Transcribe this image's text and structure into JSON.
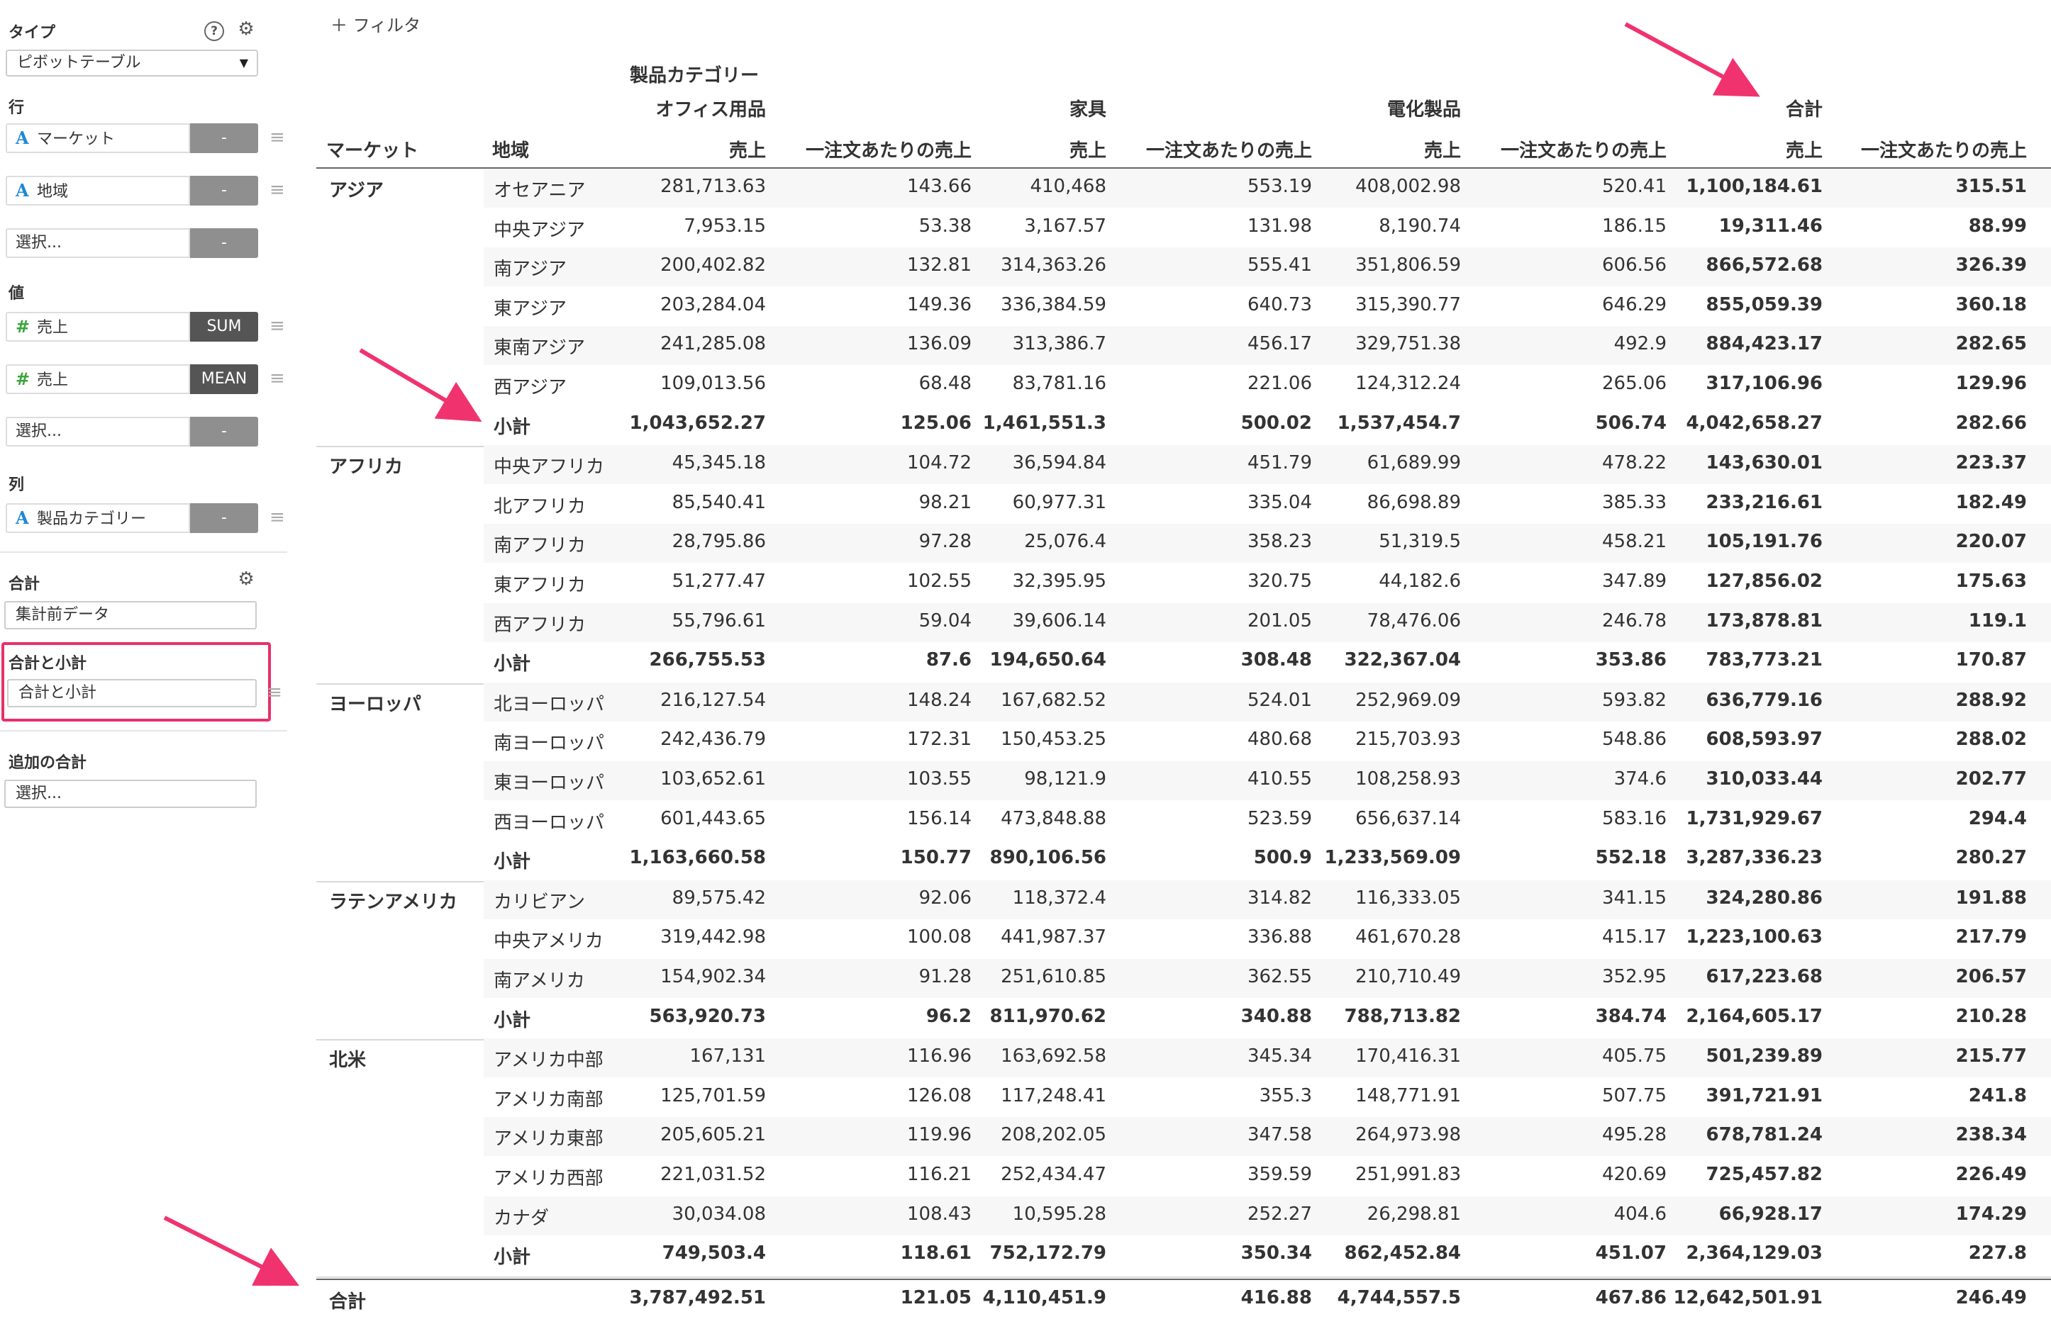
{
  "panel": {
    "type_label": "タイプ",
    "type_value": "ピボットテーブル",
    "rows_label": "行",
    "rows": [
      {
        "icon": "text-type-icon",
        "glyph": "A",
        "name": "マーケット",
        "agg": "-"
      },
      {
        "icon": "text-type-icon",
        "glyph": "A",
        "name": "地域",
        "agg": "-"
      },
      {
        "icon": "",
        "glyph": "",
        "name": "選択...",
        "agg": "-"
      }
    ],
    "values_label": "値",
    "values": [
      {
        "icon": "number-type-icon",
        "glyph": "#",
        "name": "売上",
        "agg": "SUM"
      },
      {
        "icon": "number-type-icon",
        "glyph": "#",
        "name": "売上",
        "agg": "MEAN"
      },
      {
        "icon": "",
        "glyph": "",
        "name": "選択...",
        "agg": "-"
      }
    ],
    "cols_label": "列",
    "cols": [
      {
        "icon": "text-type-icon",
        "glyph": "A",
        "name": "製品カテゴリー",
        "agg": "-"
      }
    ],
    "total_label": "合計",
    "total_value": "集計前データ",
    "subtotal_label": "合計と小計",
    "subtotal_value": "合計と小計",
    "extra_label": "追加の合計",
    "extra_value": "選択...",
    "highlight_color": "#e8306a"
  },
  "filter_label": "フィルタ",
  "table": {
    "column_group_title": "製品カテゴリー",
    "categories": [
      "オフィス用品",
      "家具",
      "電化製品",
      "合計"
    ],
    "headers": [
      "マーケット",
      "地域",
      "売上",
      "一注文あたりの売上",
      "売上",
      "一注文あたりの売上",
      "売上",
      "一注文あたりの売上",
      "売上",
      "一注文あたりの売上"
    ],
    "grand_total_label": "合計",
    "grand_total": [
      "3,787,492.51",
      "121.05",
      "4,110,451.9",
      "416.88",
      "4,744,557.5",
      "467.86",
      "12,642,501.91",
      "246.49"
    ],
    "groups": [
      {
        "market": "アジア",
        "rows": [
          {
            "region": "オセアニア",
            "v": [
              "281,713.63",
              "143.66",
              "410,468",
              "553.19",
              "408,002.98",
              "520.41",
              "1,100,184.61",
              "315.51"
            ]
          },
          {
            "region": "中央アジア",
            "v": [
              "7,953.15",
              "53.38",
              "3,167.57",
              "131.98",
              "8,190.74",
              "186.15",
              "19,311.46",
              "88.99"
            ]
          },
          {
            "region": "南アジア",
            "v": [
              "200,402.82",
              "132.81",
              "314,363.26",
              "555.41",
              "351,806.59",
              "606.56",
              "866,572.68",
              "326.39"
            ]
          },
          {
            "region": "東アジア",
            "v": [
              "203,284.04",
              "149.36",
              "336,384.59",
              "640.73",
              "315,390.77",
              "646.29",
              "855,059.39",
              "360.18"
            ]
          },
          {
            "region": "東南アジア",
            "v": [
              "241,285.08",
              "136.09",
              "313,386.7",
              "456.17",
              "329,751.38",
              "492.9",
              "884,423.17",
              "282.65"
            ]
          },
          {
            "region": "西アジア",
            "v": [
              "109,013.56",
              "68.48",
              "83,781.16",
              "221.06",
              "124,312.24",
              "265.06",
              "317,106.96",
              "129.96"
            ]
          },
          {
            "region": "小計",
            "subtotal": true,
            "v": [
              "1,043,652.27",
              "125.06",
              "1,461,551.3",
              "500.02",
              "1,537,454.7",
              "506.74",
              "4,042,658.27",
              "282.66"
            ]
          }
        ]
      },
      {
        "market": "アフリカ",
        "rows": [
          {
            "region": "中央アフリカ",
            "v": [
              "45,345.18",
              "104.72",
              "36,594.84",
              "451.79",
              "61,689.99",
              "478.22",
              "143,630.01",
              "223.37"
            ]
          },
          {
            "region": "北アフリカ",
            "v": [
              "85,540.41",
              "98.21",
              "60,977.31",
              "335.04",
              "86,698.89",
              "385.33",
              "233,216.61",
              "182.49"
            ]
          },
          {
            "region": "南アフリカ",
            "v": [
              "28,795.86",
              "97.28",
              "25,076.4",
              "358.23",
              "51,319.5",
              "458.21",
              "105,191.76",
              "220.07"
            ]
          },
          {
            "region": "東アフリカ",
            "v": [
              "51,277.47",
              "102.55",
              "32,395.95",
              "320.75",
              "44,182.6",
              "347.89",
              "127,856.02",
              "175.63"
            ]
          },
          {
            "region": "西アフリカ",
            "v": [
              "55,796.61",
              "59.04",
              "39,606.14",
              "201.05",
              "78,476.06",
              "246.78",
              "173,878.81",
              "119.1"
            ]
          },
          {
            "region": "小計",
            "subtotal": true,
            "v": [
              "266,755.53",
              "87.6",
              "194,650.64",
              "308.48",
              "322,367.04",
              "353.86",
              "783,773.21",
              "170.87"
            ]
          }
        ]
      },
      {
        "market": "ヨーロッパ",
        "rows": [
          {
            "region": "北ヨーロッパ",
            "v": [
              "216,127.54",
              "148.24",
              "167,682.52",
              "524.01",
              "252,969.09",
              "593.82",
              "636,779.16",
              "288.92"
            ]
          },
          {
            "region": "南ヨーロッパ",
            "v": [
              "242,436.79",
              "172.31",
              "150,453.25",
              "480.68",
              "215,703.93",
              "548.86",
              "608,593.97",
              "288.02"
            ]
          },
          {
            "region": "東ヨーロッパ",
            "v": [
              "103,652.61",
              "103.55",
              "98,121.9",
              "410.55",
              "108,258.93",
              "374.6",
              "310,033.44",
              "202.77"
            ]
          },
          {
            "region": "西ヨーロッパ",
            "v": [
              "601,443.65",
              "156.14",
              "473,848.88",
              "523.59",
              "656,637.14",
              "583.16",
              "1,731,929.67",
              "294.4"
            ]
          },
          {
            "region": "小計",
            "subtotal": true,
            "v": [
              "1,163,660.58",
              "150.77",
              "890,106.56",
              "500.9",
              "1,233,569.09",
              "552.18",
              "3,287,336.23",
              "280.27"
            ]
          }
        ]
      },
      {
        "market": "ラテンアメリカ",
        "rows": [
          {
            "region": "カリビアン",
            "v": [
              "89,575.42",
              "92.06",
              "118,372.4",
              "314.82",
              "116,333.05",
              "341.15",
              "324,280.86",
              "191.88"
            ]
          },
          {
            "region": "中央アメリカ",
            "v": [
              "319,442.98",
              "100.08",
              "441,987.37",
              "336.88",
              "461,670.28",
              "415.17",
              "1,223,100.63",
              "217.79"
            ]
          },
          {
            "region": "南アメリカ",
            "v": [
              "154,902.34",
              "91.28",
              "251,610.85",
              "362.55",
              "210,710.49",
              "352.95",
              "617,223.68",
              "206.57"
            ]
          },
          {
            "region": "小計",
            "subtotal": true,
            "v": [
              "563,920.73",
              "96.2",
              "811,970.62",
              "340.88",
              "788,713.82",
              "384.74",
              "2,164,605.17",
              "210.28"
            ]
          }
        ]
      },
      {
        "market": "北米",
        "rows": [
          {
            "region": "アメリカ中部",
            "v": [
              "167,131",
              "116.96",
              "163,692.58",
              "345.34",
              "170,416.31",
              "405.75",
              "501,239.89",
              "215.77"
            ]
          },
          {
            "region": "アメリカ南部",
            "v": [
              "125,701.59",
              "126.08",
              "117,248.41",
              "355.3",
              "148,771.91",
              "507.75",
              "391,721.91",
              "241.8"
            ]
          },
          {
            "region": "アメリカ東部",
            "v": [
              "205,605.21",
              "119.96",
              "208,202.05",
              "347.58",
              "264,973.98",
              "495.28",
              "678,781.24",
              "238.34"
            ]
          },
          {
            "region": "アメリカ西部",
            "v": [
              "221,031.52",
              "116.21",
              "252,434.47",
              "359.59",
              "251,991.83",
              "420.69",
              "725,457.82",
              "226.49"
            ]
          },
          {
            "region": "カナダ",
            "v": [
              "30,034.08",
              "108.43",
              "10,595.28",
              "252.27",
              "26,298.81",
              "404.6",
              "66,928.17",
              "174.29"
            ]
          },
          {
            "region": "小計",
            "subtotal": true,
            "v": [
              "749,503.4",
              "118.61",
              "752,172.79",
              "350.34",
              "862,452.84",
              "451.07",
              "2,364,129.03",
              "227.8"
            ]
          }
        ]
      }
    ]
  },
  "arrow_color": "#f0336f"
}
